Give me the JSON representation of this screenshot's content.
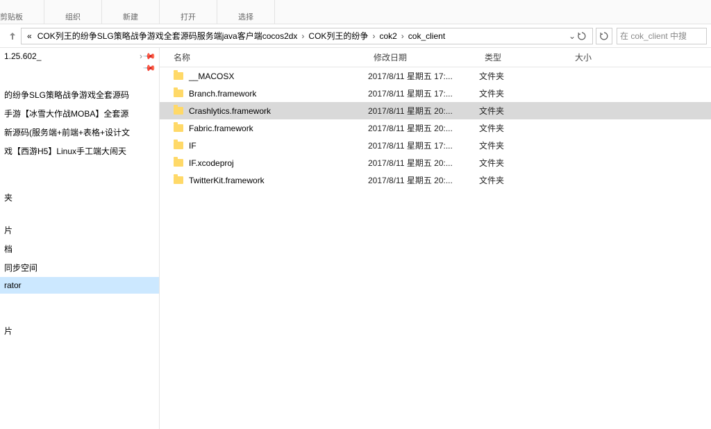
{
  "ribbon": {
    "clipboard": "剪贴板",
    "organize": "组织",
    "new": "新建",
    "open": "打开",
    "select": "选择"
  },
  "breadcrumb": {
    "prefix": "«",
    "parts": [
      "COK列王的纷争SLG策略战争游戏全套源码服务端java客户端cocos2dx",
      "COK列王的纷争",
      "cok2",
      "cok_client"
    ]
  },
  "search": {
    "placeholder": "在 cok_client 中搜"
  },
  "nav": {
    "quick": [
      "1.25.602_",
      ""
    ],
    "projects": [
      "的纷争SLG策略战争游戏全套源码",
      "手游【冰雪大作战MOBA】全套源",
      "新源码(服务端+前端+表格+设计文",
      "戏【西游H5】Linux手工端大闹天"
    ],
    "sections": [
      "夹",
      "片",
      "档",
      "同步空间",
      "rator"
    ],
    "other": [
      "片"
    ]
  },
  "columns": {
    "name": "名称",
    "date": "修改日期",
    "type": "类型",
    "size": "大小"
  },
  "files": [
    {
      "name": "__MACOSX",
      "date": "2017/8/11 星期五 17:...",
      "type": "文件夹",
      "selected": false
    },
    {
      "name": "Branch.framework",
      "date": "2017/8/11 星期五 17:...",
      "type": "文件夹",
      "selected": false
    },
    {
      "name": "Crashlytics.framework",
      "date": "2017/8/11 星期五 20:...",
      "type": "文件夹",
      "selected": true
    },
    {
      "name": "Fabric.framework",
      "date": "2017/8/11 星期五 20:...",
      "type": "文件夹",
      "selected": false
    },
    {
      "name": "IF",
      "date": "2017/8/11 星期五 17:...",
      "type": "文件夹",
      "selected": false
    },
    {
      "name": "IF.xcodeproj",
      "date": "2017/8/11 星期五 20:...",
      "type": "文件夹",
      "selected": false
    },
    {
      "name": "TwitterKit.framework",
      "date": "2017/8/11 星期五 20:...",
      "type": "文件夹",
      "selected": false
    }
  ]
}
